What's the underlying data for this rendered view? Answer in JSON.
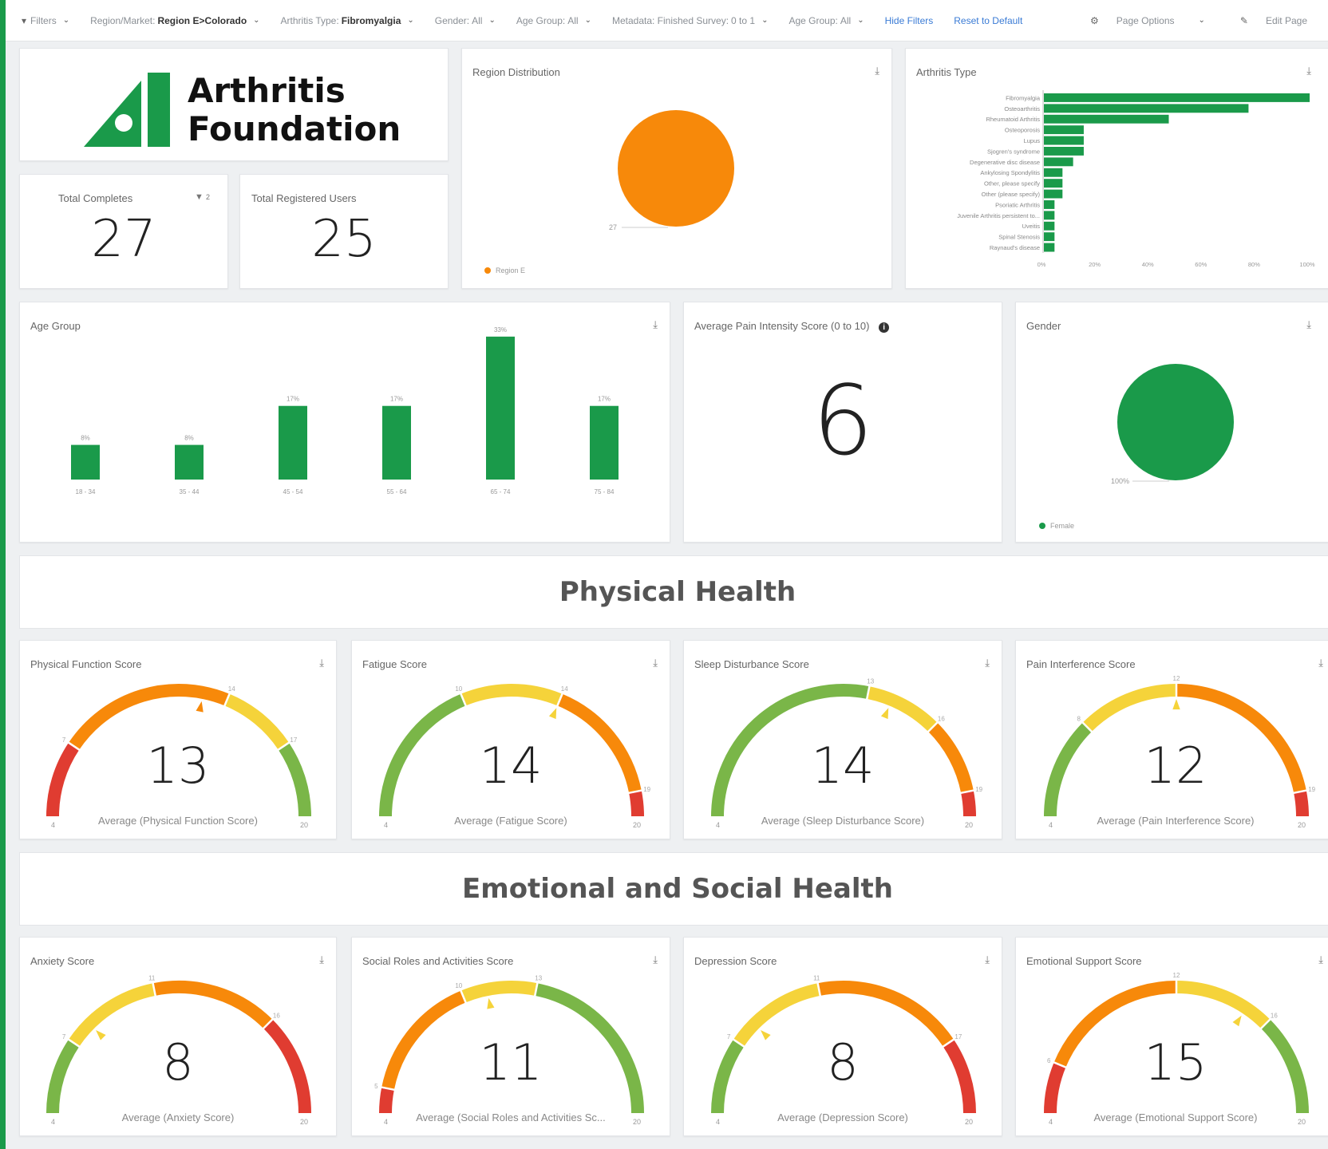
{
  "filters": {
    "label": "Filters",
    "items": [
      {
        "key": "Region/Market:",
        "value": "Region E>Colorado",
        "bold": true
      },
      {
        "key": "Arthritis Type:",
        "value": "Fibromyalgia",
        "bold": true
      },
      {
        "key": "Gender:",
        "value": "All",
        "bold": false
      },
      {
        "key": "Age Group:",
        "value": "All",
        "bold": false
      },
      {
        "key": "Metadata: Finished Survey:",
        "value": "0 to 1",
        "bold": false
      },
      {
        "key": "Age Group:",
        "value": "All",
        "bold": false
      }
    ],
    "hide_filters": "Hide Filters",
    "reset_default": "Reset to Default",
    "page_options": "Page Options",
    "edit_page": "Edit Page"
  },
  "logo": {
    "line1": "Arthritis",
    "line2": "Foundation",
    "brand_color": "#1a9a4a"
  },
  "kpis": {
    "total_completes": {
      "label": "Total Completes",
      "value": "27",
      "filter_count": "2"
    },
    "total_registered": {
      "label": "Total Registered Users",
      "value": "25"
    }
  },
  "region_distribution": {
    "title": "Region Distribution",
    "chart_data": {
      "type": "pie",
      "slices": [
        {
          "label": "Region E",
          "value": 27
        }
      ],
      "color": "#f7890a",
      "data_label": "27",
      "legend": "Region E"
    }
  },
  "arthritis_type": {
    "title": "Arthritis Type",
    "chart_data": {
      "type": "bar",
      "orientation": "horizontal",
      "categories": [
        "Fibromyalgia",
        "Osteoarthritis",
        "Rheumatoid Arthritis",
        "Osteoporosis",
        "Lupus",
        "Sjogren's syndrome",
        "Degenerative disc disease",
        "Ankylosing Spondylitis",
        "Other, please specify",
        "Other (please specify)",
        "Psoriatic Arthritis",
        "Juvenile Arthritis persistent to...",
        "Uveitis",
        "Spinal Stenosis",
        "Raynaud's disease"
      ],
      "values": [
        100,
        77,
        47,
        15,
        15,
        15,
        11,
        7,
        7,
        7,
        4,
        4,
        4,
        4,
        4
      ],
      "xticks": [
        "0%",
        "20%",
        "40%",
        "60%",
        "80%",
        "100%"
      ],
      "xlim": [
        0,
        100
      ],
      "color": "#1a9a4a"
    }
  },
  "age_group": {
    "title": "Age Group",
    "chart_data": {
      "type": "bar",
      "categories": [
        "18 - 34",
        "35 - 44",
        "45 - 54",
        "55 - 64",
        "65 - 74",
        "75 - 84"
      ],
      "values": [
        8,
        8,
        17,
        17,
        33,
        17
      ],
      "labels": [
        "8%",
        "8%",
        "17%",
        "17%",
        "33%",
        "17%"
      ],
      "ylim": [
        0,
        35
      ],
      "color": "#1a9a4a"
    }
  },
  "pain_intensity": {
    "title": "Average Pain Intensity Score (0 to 10)",
    "value": "6"
  },
  "gender": {
    "title": "Gender",
    "chart_data": {
      "type": "pie",
      "slices": [
        {
          "label": "Female",
          "value": 100
        }
      ],
      "color": "#1a9a4a",
      "data_label": "100%",
      "legend": "Female"
    }
  },
  "sections": {
    "physical": "Physical Health",
    "emotional": "Emotional and Social Health"
  },
  "gauges": [
    {
      "title": "Physical Function Score",
      "value": "13",
      "avg": "Average (Physical Function Score)",
      "min": "4",
      "max": "20",
      "num": 13,
      "bands": [
        [
          "#e03c31",
          4,
          7
        ],
        [
          "#f7890a",
          7,
          14
        ],
        [
          "#f5d33a",
          14,
          17
        ],
        [
          "#7ab648",
          17,
          20
        ]
      ],
      "ticks": [
        "7",
        "14",
        "17"
      ]
    },
    {
      "title": "Fatigue Score",
      "value": "14",
      "avg": "Average (Fatigue Score)",
      "min": "4",
      "max": "20",
      "num": 14,
      "bands": [
        [
          "#7ab648",
          4,
          10
        ],
        [
          "#f5d33a",
          10,
          14
        ],
        [
          "#f7890a",
          14,
          19
        ],
        [
          "#e03c31",
          19,
          20
        ]
      ],
      "ticks": [
        "10",
        "14",
        "19"
      ]
    },
    {
      "title": "Sleep Disturbance Score",
      "value": "14",
      "avg": "Average (Sleep Disturbance Score)",
      "min": "4",
      "max": "20",
      "num": 14,
      "bands": [
        [
          "#7ab648",
          4,
          13
        ],
        [
          "#f5d33a",
          13,
          16
        ],
        [
          "#f7890a",
          16,
          19
        ],
        [
          "#e03c31",
          19,
          20
        ]
      ],
      "ticks": [
        "13",
        "16",
        "19"
      ]
    },
    {
      "title": "Pain Interference Score",
      "value": "12",
      "avg": "Average (Pain Interference Score)",
      "min": "4",
      "max": "20",
      "num": 12,
      "bands": [
        [
          "#7ab648",
          4,
          8
        ],
        [
          "#f5d33a",
          8,
          12
        ],
        [
          "#f7890a",
          12,
          19
        ],
        [
          "#e03c31",
          19,
          20
        ]
      ],
      "ticks": [
        "8",
        "12",
        "19"
      ]
    },
    {
      "title": "Anxiety Score",
      "value": "8",
      "avg": "Average (Anxiety Score)",
      "min": "4",
      "max": "20",
      "num": 8,
      "bands": [
        [
          "#7ab648",
          4,
          7
        ],
        [
          "#f5d33a",
          7,
          11
        ],
        [
          "#f7890a",
          11,
          16
        ],
        [
          "#e03c31",
          16,
          20
        ]
      ],
      "ticks": [
        "7",
        "11",
        "16"
      ]
    },
    {
      "title": "Social Roles and Activities Score",
      "value": "11",
      "avg": "Average (Social Roles and Activities Sc...",
      "min": "4",
      "max": "20",
      "num": 11,
      "bands": [
        [
          "#e03c31",
          4,
          5
        ],
        [
          "#f7890a",
          5,
          10
        ],
        [
          "#f5d33a",
          10,
          13
        ],
        [
          "#7ab648",
          13,
          20
        ]
      ],
      "ticks": [
        "5",
        "10",
        "13"
      ]
    },
    {
      "title": "Depression Score",
      "value": "8",
      "avg": "Average (Depression Score)",
      "min": "4",
      "max": "20",
      "num": 8,
      "bands": [
        [
          "#7ab648",
          4,
          7
        ],
        [
          "#f5d33a",
          7,
          11
        ],
        [
          "#f7890a",
          11,
          17
        ],
        [
          "#e03c31",
          17,
          20
        ]
      ],
      "ticks": [
        "7",
        "11",
        "17"
      ]
    },
    {
      "title": "Emotional Support Score",
      "value": "15",
      "avg": "Average (Emotional Support Score)",
      "min": "4",
      "max": "20",
      "num": 15,
      "bands": [
        [
          "#e03c31",
          4,
          6
        ],
        [
          "#f7890a",
          6,
          12
        ],
        [
          "#f5d33a",
          12,
          16
        ],
        [
          "#7ab648",
          16,
          20
        ]
      ],
      "ticks": [
        "6",
        "12",
        "16"
      ]
    }
  ]
}
